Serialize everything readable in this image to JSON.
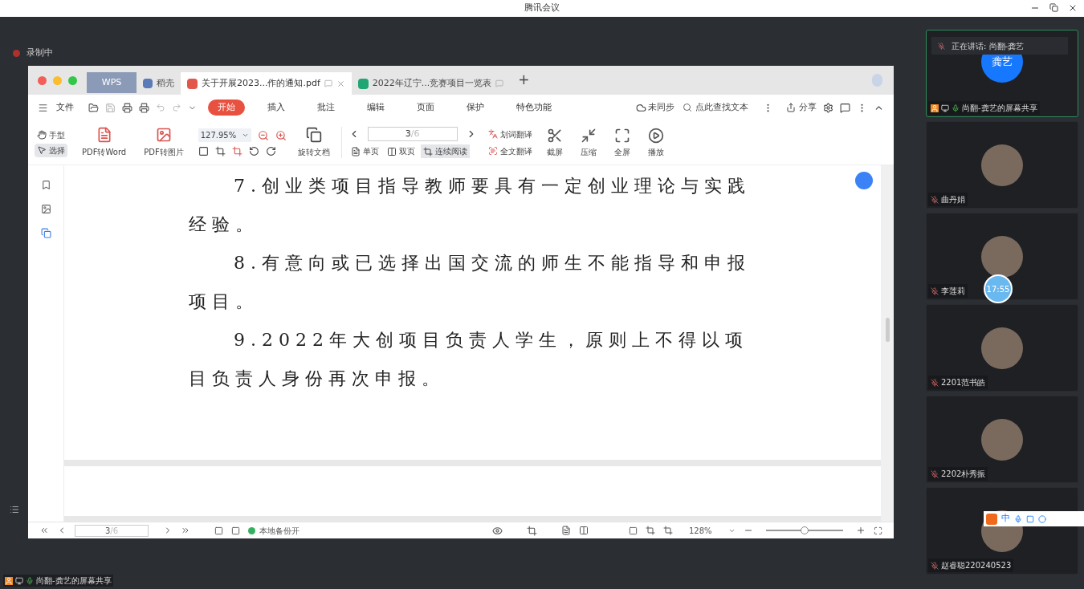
{
  "window": {
    "title": "腾讯会议"
  },
  "recording": {
    "label": "录制中"
  },
  "wps": {
    "tabs": [
      {
        "kind": "brand",
        "label": "WPS",
        "selected": false
      },
      {
        "kind": "app",
        "label": "稻壳",
        "selected": false
      },
      {
        "kind": "pdf",
        "label": "关于开展2023...作的通知.pdf",
        "selected": true
      },
      {
        "kind": "sheet",
        "label": "2022年辽宁...竞赛项目一览表",
        "selected": false
      }
    ],
    "add_tab": "+",
    "menu": {
      "file": "文件",
      "tabs": [
        {
          "label": "开始",
          "selected": true
        },
        {
          "label": "插入",
          "selected": false
        },
        {
          "label": "批注",
          "selected": false
        },
        {
          "label": "编辑",
          "selected": false
        },
        {
          "label": "页面",
          "selected": false
        },
        {
          "label": "保护",
          "selected": false
        },
        {
          "label": "特色功能",
          "selected": false
        }
      ],
      "sync": "未同步",
      "search_placeholder": "点此查找文本",
      "share": "分享"
    },
    "toolbar": {
      "modes": [
        {
          "kind": "hand",
          "label": "手型",
          "selected": false
        },
        {
          "kind": "select",
          "label": "选择",
          "selected": true
        }
      ],
      "convert": [
        {
          "kind": "word",
          "label": "PDF转Word"
        },
        {
          "kind": "image",
          "label": "PDF转图片"
        }
      ],
      "zoom": "127.95%",
      "rotate": "旋转文档",
      "page": "3",
      "page_total": "/6",
      "views": [
        {
          "kind": "single",
          "label": "单页",
          "selected": false
        },
        {
          "kind": "double",
          "label": "双页",
          "selected": false
        },
        {
          "kind": "continuous",
          "label": "连续阅读",
          "selected": true
        }
      ],
      "translate": [
        {
          "kind": "word",
          "label": "划词翻译"
        },
        {
          "kind": "full",
          "label": "全文翻译"
        }
      ],
      "tools": [
        {
          "kind": "screenshot",
          "label": "截屏"
        },
        {
          "kind": "compress",
          "label": "压缩"
        },
        {
          "kind": "fullscreen",
          "label": "全屏"
        },
        {
          "kind": "play",
          "label": "播放"
        }
      ]
    },
    "document": {
      "paragraphs": [
        "7.创业类项目指导教师要具有一定创业理论与实践经验。",
        "8.有意向或已选择出国交流的师生不能指导和申报项目。",
        "9.2022年大创项目负责人学生，原则上不得以项目负责人身份再次申报。"
      ]
    },
    "status_bar": {
      "page": "3",
      "page_total": "/6",
      "backup": "本地备份开",
      "zoom": "128%",
      "zoom_slider": {
        "level": 0.5
      }
    }
  },
  "participants": [
    {
      "name": "尚翻-龚艺的屏幕共享",
      "kind": "initials",
      "initials": "龚艺",
      "speaking": true,
      "banner": "正在讲话: 尚翻-龚艺"
    },
    {
      "name": "曲丹娟",
      "kind": "photo",
      "speaking": false
    },
    {
      "name": "李莲莉",
      "kind": "photo",
      "speaking": false
    },
    {
      "name": "2201范书皓",
      "kind": "photo",
      "speaking": false
    },
    {
      "name": "2202朴秀振",
      "kind": "photo",
      "speaking": false
    },
    {
      "name": "赵睿聪220240523",
      "kind": "photo",
      "speaking": false
    }
  ],
  "timer": "17:55",
  "ime": {
    "label": "中"
  },
  "share_bar": {
    "label": "尚翻-龚艺的屏幕共享"
  }
}
